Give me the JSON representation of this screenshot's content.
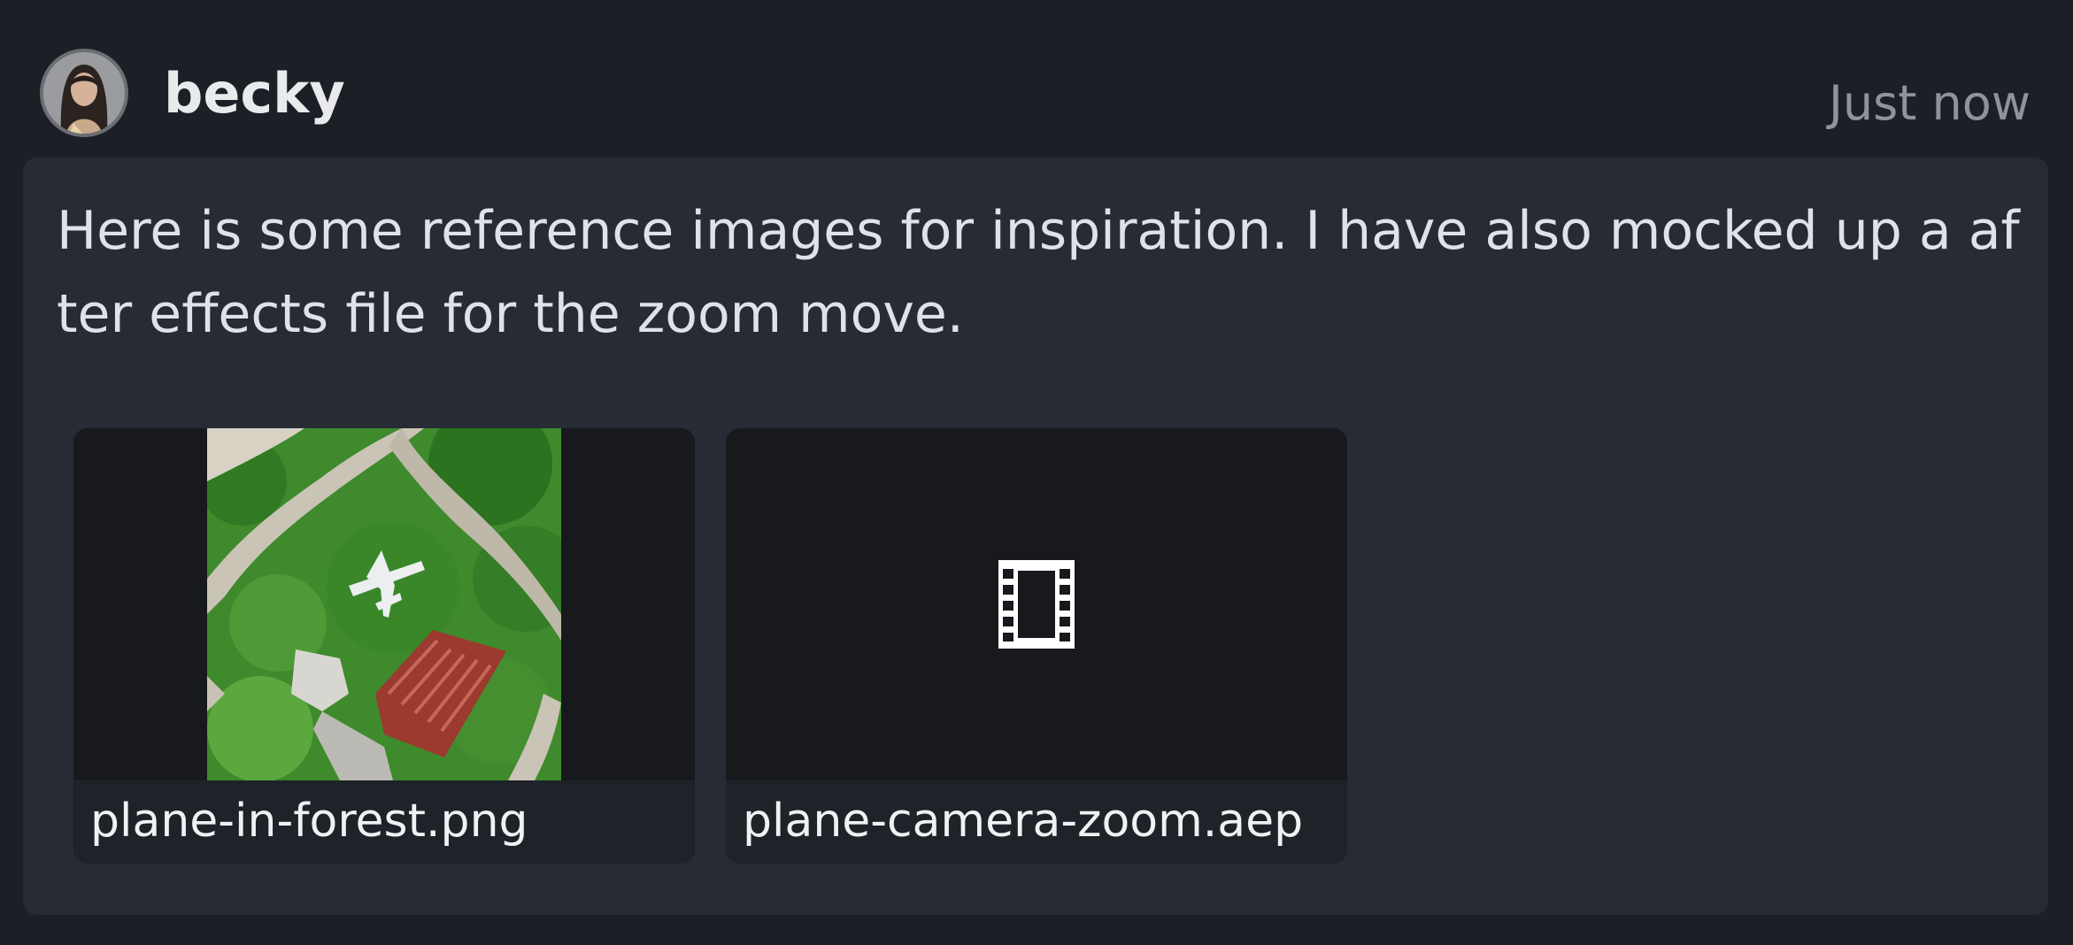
{
  "post": {
    "username": "becky",
    "timestamp": "Just now",
    "message": "Here is some reference images for inspiration. I have also mocked up a after effects file for the zoom move."
  },
  "attachments": [
    {
      "filename": "plane-in-forest.png",
      "preview": "image-thumbnail"
    },
    {
      "filename": "plane-camera-zoom.aep",
      "preview": "film-icon"
    }
  ],
  "colors": {
    "background": "#1c1f26",
    "bubble": "#262b34",
    "card": "#1b1d21",
    "muted_text": "#8f939a"
  }
}
